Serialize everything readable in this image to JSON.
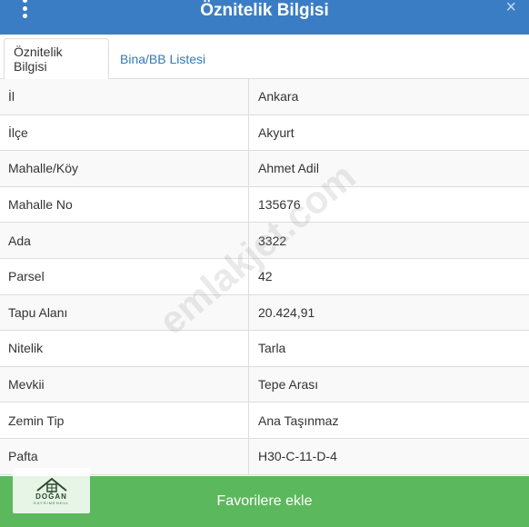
{
  "header": {
    "title": "Öznitelik Bilgisi",
    "menu_icon": "vertical-dots-icon",
    "close_icon": "close-icon",
    "close_label": "×"
  },
  "tabs": [
    {
      "label": "Öznitelik Bilgisi",
      "active": true
    },
    {
      "label": "Bina/BB Listesi",
      "active": false
    }
  ],
  "rows": [
    {
      "key": "İl",
      "value": "Ankara"
    },
    {
      "key": "İlçe",
      "value": "Akyurt"
    },
    {
      "key": "Mahalle/Köy",
      "value": "Ahmet Adil"
    },
    {
      "key": "Mahalle No",
      "value": "135676"
    },
    {
      "key": "Ada",
      "value": "3322"
    },
    {
      "key": "Parsel",
      "value": "42"
    },
    {
      "key": "Tapu Alanı",
      "value": "20.424,91"
    },
    {
      "key": "Nitelik",
      "value": "Tarla"
    },
    {
      "key": "Mevkii",
      "value": "Tepe Arası"
    },
    {
      "key": "Zemin Tip",
      "value": "Ana Taşınmaz"
    },
    {
      "key": "Pafta",
      "value": "H30-C-11-D-4"
    }
  ],
  "footer": {
    "button_label": "Favorilere ekle"
  },
  "watermark": "emlakjet.com",
  "logo": {
    "name": "DOĞAN",
    "sub": "GAYRIMENKUL"
  },
  "colors": {
    "header": "#3b7dc4",
    "footer": "#5cb85c",
    "tab_link": "#337ab7"
  }
}
